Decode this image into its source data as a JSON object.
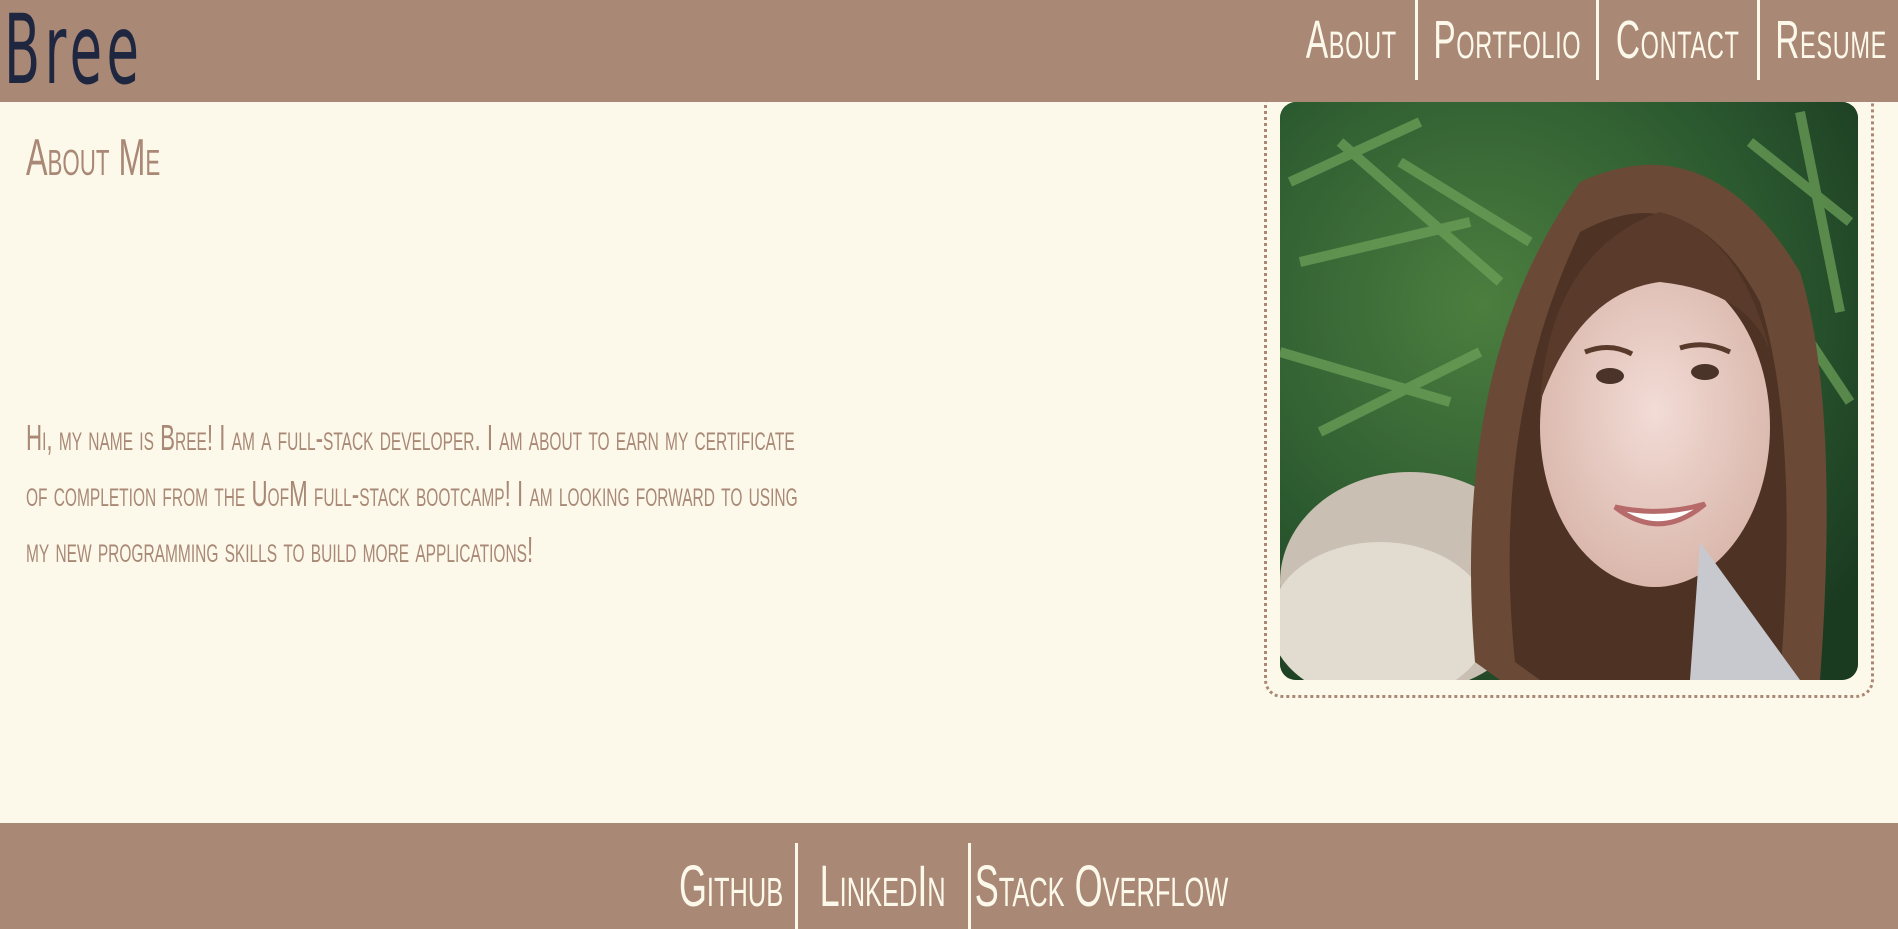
{
  "header": {
    "brand": "Bree",
    "nav": [
      {
        "label": "About"
      },
      {
        "label": "Portfolio"
      },
      {
        "label": "Contact"
      },
      {
        "label": "Resume"
      }
    ]
  },
  "main": {
    "title": "About Me",
    "bio_lines": [
      "Hi, my name is Bree! I am a full-stack developer. I am about to earn my certificate",
      "of completion from the UofM full-stack bootcamp! I am looking forward to using",
      "my new programming skills to build more applications!"
    ],
    "photo": {
      "icon": "profile-photo"
    }
  },
  "footer": {
    "links": [
      {
        "label": "Github"
      },
      {
        "label": "LinkedIn"
      },
      {
        "label": "Stack Overflow"
      }
    ]
  },
  "colors": {
    "header_bg": "#a98876",
    "page_bg": "#fdf9ea",
    "brand_text": "#1f2740",
    "accent_text": "#a98876"
  }
}
